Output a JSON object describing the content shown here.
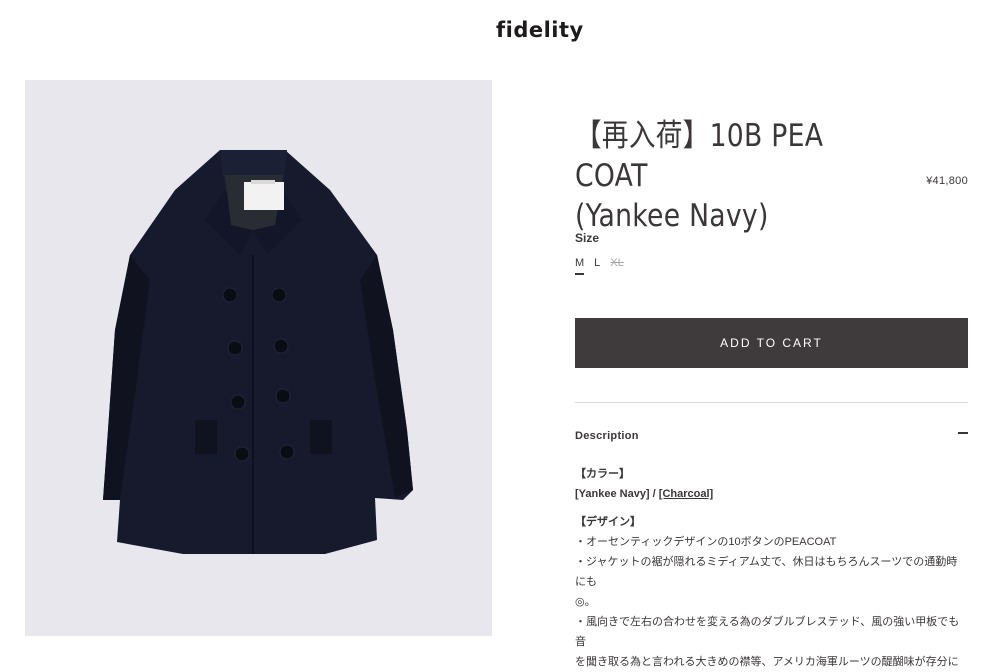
{
  "header": {
    "logo": "fidelity"
  },
  "product": {
    "title_line1": "【再入荷】10B PEA COAT",
    "title_line2": "(Yankee Navy)",
    "price": "¥41,800",
    "image_alt": "navy pea coat product photo"
  },
  "size": {
    "label": "Size",
    "options": [
      {
        "label": "M",
        "state": "selected"
      },
      {
        "label": "L",
        "state": "available"
      },
      {
        "label": "XL",
        "state": "sold-out"
      }
    ]
  },
  "cart": {
    "button_label": "ADD TO CART"
  },
  "description": {
    "label": "Description",
    "color_heading": "【カラー】",
    "color_current": "[Yankee Navy]",
    "color_separator": " / ",
    "color_link": "[Charcoal]",
    "design_heading": "【デザイン】",
    "lines": [
      "・オーセンティックデザインの10ボタンのPEACOAT",
      "・ジャケットの裾が隠れるミディアム丈で、休日はもちろんスーツでの通勤時にも",
      "◎。",
      "・風向きで左右の合わせを変える為のダブルブレステッド、風の強い甲板でも音",
      "を聞き取る為と言われる大きめの襟等、アメリカ海軍ルーツの醍醐味が存分に"
    ]
  },
  "colors": {
    "button_bg": "#3f3a3b",
    "image_bg": "#e8e7ed",
    "coat": "#161a2c"
  }
}
